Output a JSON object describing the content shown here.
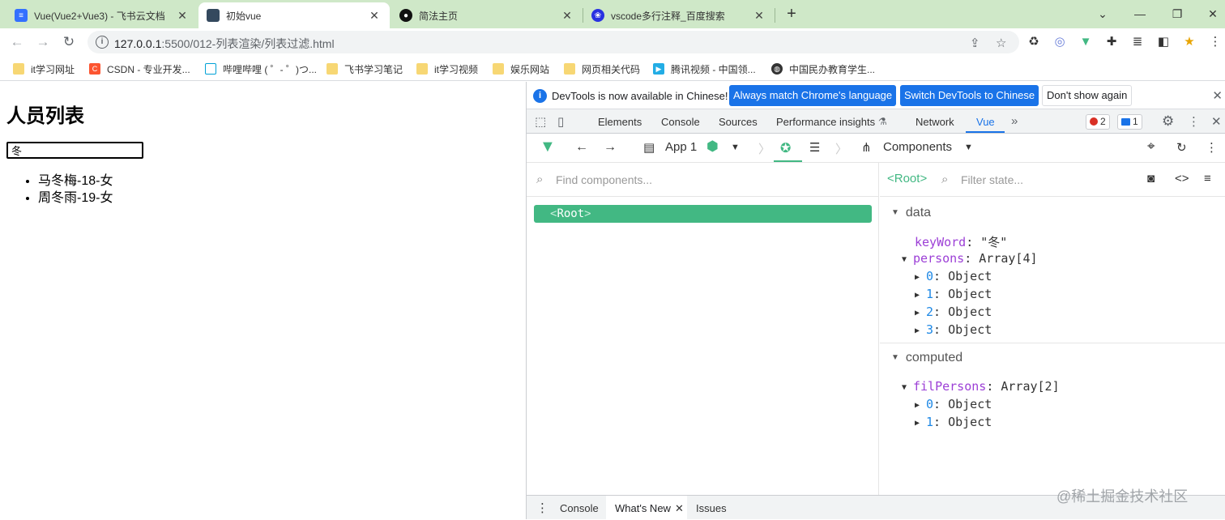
{
  "tabs": [
    {
      "title": "Vue(Vue2+Vue3) - 飞书云文档",
      "active": false
    },
    {
      "title": "初始vue",
      "active": true
    },
    {
      "title": "简法主页",
      "active": false
    },
    {
      "title": "vscode多行注释_百度搜索",
      "active": false
    }
  ],
  "address": {
    "host": "127.0.0.1",
    "path": ":5500/012-列表渲染/列表过滤.html"
  },
  "bookmarks": [
    {
      "label": "it学习网址"
    },
    {
      "label": "CSDN - 专业开发..."
    },
    {
      "label": "哔哩哔哩 ( ゜- ゜)つ..."
    },
    {
      "label": "飞书学习笔记"
    },
    {
      "label": "it学习视频"
    },
    {
      "label": "娱乐网站"
    },
    {
      "label": "网页相关代码"
    },
    {
      "label": "腾讯视频 - 中国领..."
    },
    {
      "label": "中国民办教育学生..."
    }
  ],
  "page": {
    "heading": "人员列表",
    "input_value": "冬",
    "items": [
      "马冬梅-18-女",
      "周冬雨-19-女"
    ]
  },
  "devtools": {
    "info_message": "DevTools is now available in Chinese!",
    "btn_match": "Always match Chrome's language",
    "btn_switch": "Switch DevTools to Chinese",
    "btn_dont": "Don't show again",
    "tabs": [
      "Elements",
      "Console",
      "Sources",
      "Performance insights",
      "Network",
      "Vue"
    ],
    "errors": "2",
    "messages": "1"
  },
  "vue": {
    "app_label": "App 1",
    "components_label": "Components",
    "find_placeholder": "Find components...",
    "root_label": "Root",
    "state_root": "<Root>",
    "filter_placeholder": "Filter state...",
    "data_title": "data",
    "computed_title": "computed",
    "keyword_key": "keyWord",
    "keyword_value": "\"冬\"",
    "persons_key": "persons",
    "persons_value": "Array[4]",
    "persons_items": [
      {
        "idx": "0",
        "value": "Object"
      },
      {
        "idx": "1",
        "value": "Object"
      },
      {
        "idx": "2",
        "value": "Object"
      },
      {
        "idx": "3",
        "value": "Object"
      }
    ],
    "filpersons_key": "filPersons",
    "filpersons_value": "Array[2]",
    "filpersons_items": [
      {
        "idx": "0",
        "value": "Object"
      },
      {
        "idx": "1",
        "value": "Object"
      }
    ]
  },
  "drawer": {
    "tabs": [
      "Console",
      "What's New",
      "Issues"
    ]
  },
  "watermark": "@稀土掘金技术社区",
  "colors": {
    "vue_green": "#42b883",
    "chrome_blue": "#1a73e8",
    "tabstrip": "#cfe8c8"
  }
}
